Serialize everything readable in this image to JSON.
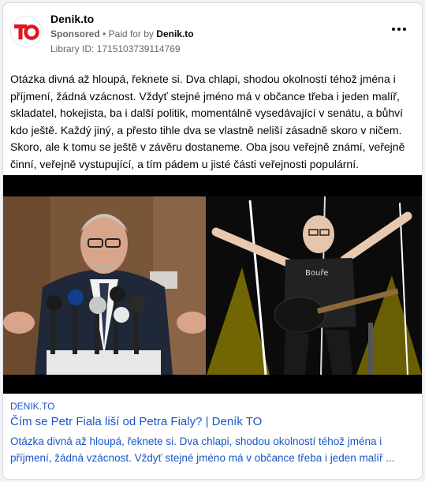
{
  "ad": {
    "page_name": "Denik.to",
    "sponsored": "Sponsored",
    "separator": "•",
    "paid_for_by_label": "Paid for by",
    "paid_for_by": "Denik.to",
    "library_id": "Library ID: 1715103739114769",
    "logo_text": "TO",
    "body": "Otázka divná až hloupá, řeknete si. Dva chlapi, shodou okolností téhož jména i příjmení, žádná vzácnost. Vždyť stejné jméno má v občance třeba i jeden malíř, skladatel, hokejista, ba i další politik, momentálně vysedávající v senátu, a bůhví kdo ještě. Každý jiný, a přesto tihle dva se vlastně neliší zásadně skoro v ničem. Skoro, ale k tomu se ještě v závěru dostaneme. Oba jsou veřejně známí, veřejně činní, veřejně vystupující, a tím pádem u jisté části veřejnosti populární.",
    "shirt_text": "Bouře"
  },
  "link": {
    "domain": "DENIK.TO",
    "headline": "Čím se Petr Fiala liší od Petra Fialy? | Deník TO",
    "description": "Otázka divná až hloupá, řeknete si. Dva chlapi, shodou okolností téhož jména i příjmení, žádná vzácnost. Vždyť stejné jméno má v občance třeba i jeden malíř ..."
  },
  "colors": {
    "brand_red": "#e3141b",
    "link_blue": "#1a56c9",
    "muted": "#65676b"
  },
  "icons": {
    "more": "more-horizontal-icon"
  }
}
